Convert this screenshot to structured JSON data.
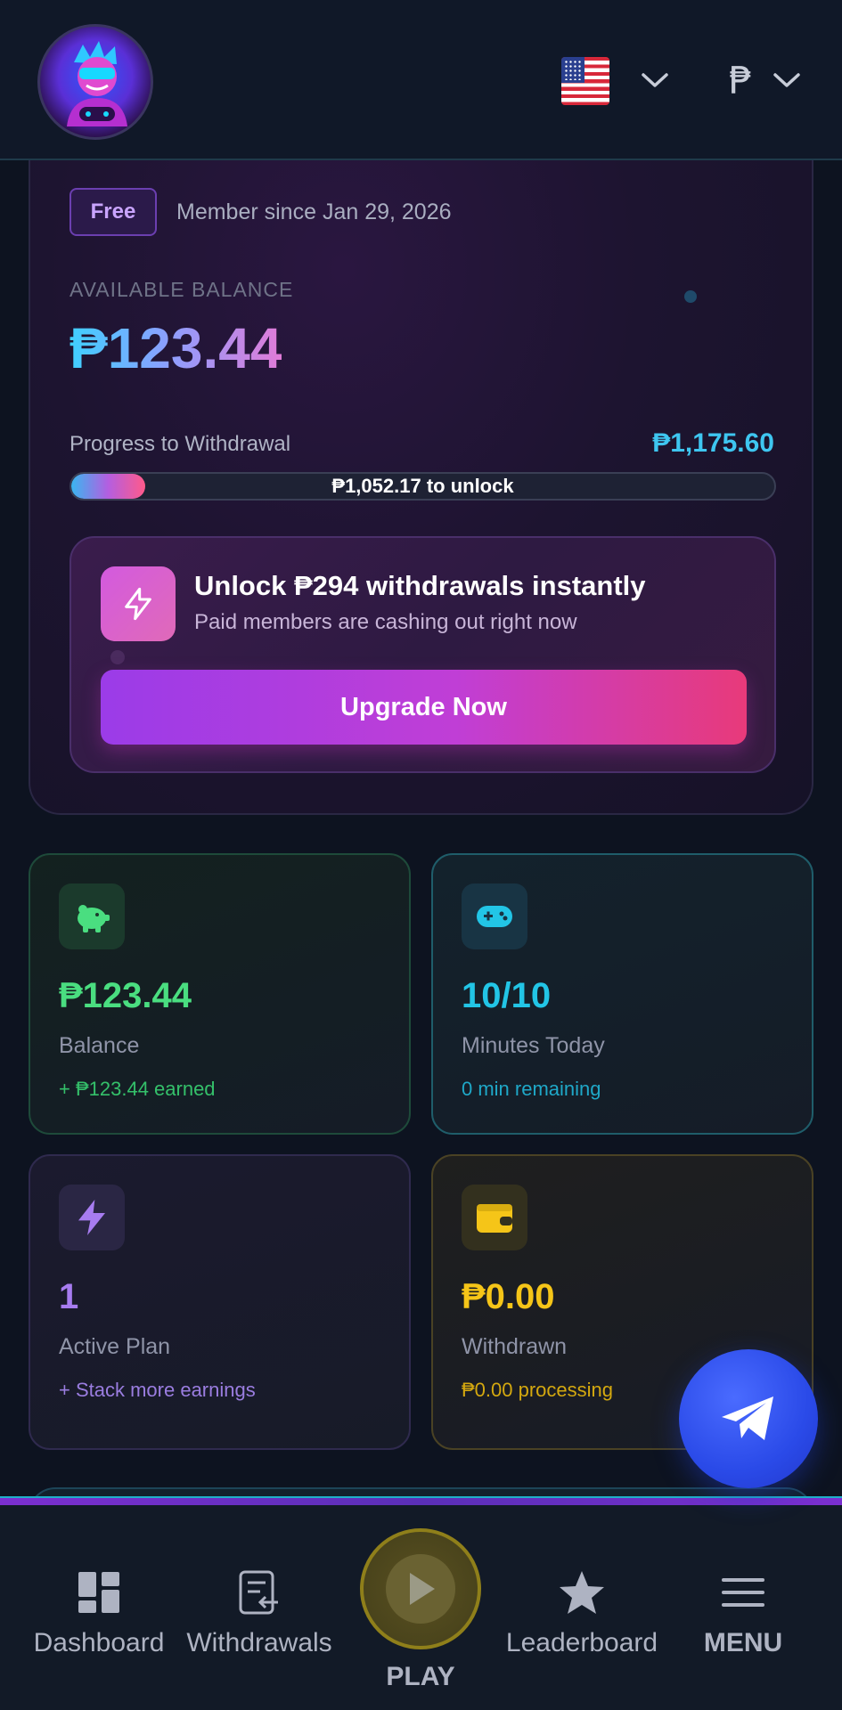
{
  "header": {
    "currency_symbol": "₱"
  },
  "account": {
    "tier_badge": "Free",
    "member_since": "Member since Jan 29, 2026",
    "available_label": "AVAILABLE BALANCE",
    "available_amount": "₱123.44"
  },
  "progress": {
    "label": "Progress to Withdrawal",
    "target": "₱1,175.60",
    "bar_text": "₱1,052.17 to unlock",
    "fraction": 0.105
  },
  "unlock": {
    "title": "Unlock ₱294 withdrawals instantly",
    "subtitle": "Paid members are cashing out right now",
    "button": "Upgrade Now"
  },
  "stats": {
    "balance": {
      "value": "₱123.44",
      "label": "Balance",
      "sub": "+ ₱123.44 earned",
      "icon": "piggy-bank-icon",
      "color": "#4ade80"
    },
    "minutes": {
      "value": "10/10",
      "label": "Minutes Today",
      "sub": "0 min remaining",
      "icon": "gamepad-icon",
      "color": "#22c5e6"
    },
    "plan": {
      "value": "1",
      "label": "Active Plan",
      "sub": "+ Stack more earnings",
      "icon": "lightning-icon",
      "color": "#a77cf0"
    },
    "withdrawn": {
      "value": "₱0.00",
      "label": "Withdrawn",
      "sub": "₱0.00 processing",
      "icon": "wallet-icon",
      "color": "#f5c518"
    }
  },
  "nav": {
    "dashboard": "Dashboard",
    "withdrawals": "Withdrawals",
    "play": "PLAY",
    "leaderboard": "Leaderboard",
    "menu": "MENU"
  }
}
